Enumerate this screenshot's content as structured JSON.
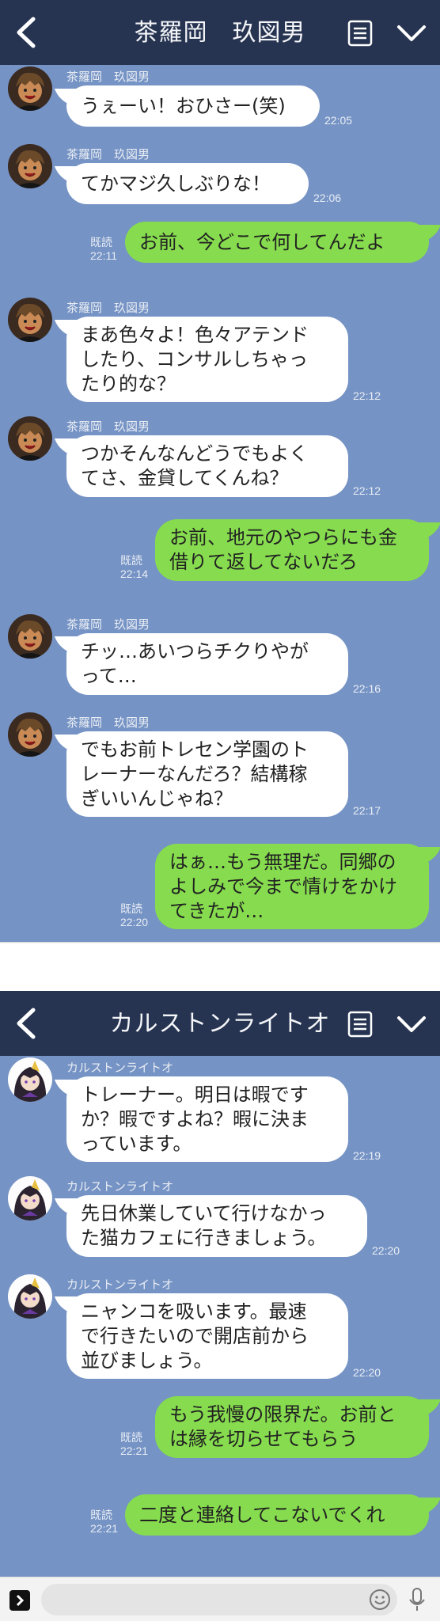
{
  "chat1": {
    "title": "茶羅岡　玖図男",
    "messages": [
      {
        "type": "in",
        "name": "茶羅岡　玖図男",
        "text": "うぇーい！おひさー(笑)",
        "time": "22:05"
      },
      {
        "type": "in",
        "name": "茶羅岡　玖図男",
        "text": "てかマジ久しぶりな！",
        "time": "22:06"
      },
      {
        "type": "out",
        "read": "既読",
        "text": "お前、今どこで何してんだよ",
        "time": "22:11"
      },
      {
        "type": "in",
        "name": "茶羅岡　玖図男",
        "text": "まあ色々よ！色々アテンド\nしたり、コンサルしちゃっ\nたり的な？",
        "time": "22:12"
      },
      {
        "type": "in",
        "name": "茶羅岡　玖図男",
        "text": "つかそんなんどうでもよく\nてさ、金貸してくんね？",
        "time": "22:12"
      },
      {
        "type": "out",
        "read": "既読",
        "text": "お前、地元のやつらにも金\n借りて返してないだろ",
        "time": "22:14"
      },
      {
        "type": "in",
        "name": "茶羅岡　玖図男",
        "text": "チッ…あいつらチクりやが\nって…",
        "time": "22:16"
      },
      {
        "type": "in",
        "name": "茶羅岡　玖図男",
        "text": "でもお前トレセン学園のト\nレーナーなんだろ？結構稼\nぎいいんじゃね？",
        "time": "22:17"
      },
      {
        "type": "out",
        "read": "既読",
        "text": "はぁ…もう無理だ。同郷の\nよしみで今まで情けをかけ\nてきたが…",
        "time": "22:20"
      }
    ]
  },
  "chat2": {
    "title": "カルストンライトオ",
    "messages": [
      {
        "type": "in",
        "name": "カルストンライトオ",
        "text": "トレーナー。明日は暇です\nか？暇ですよね？暇に決ま\nっています。",
        "time": "22:19"
      },
      {
        "type": "in",
        "name": "カルストンライトオ",
        "text": "先日休業していて行けなかっ\nた猫カフェに行きましょう。",
        "time": "22:20"
      },
      {
        "type": "in",
        "name": "カルストンライトオ",
        "text": "ニャンコを吸います。最速\nで行きたいので開店前から\n並びましょう。",
        "time": "22:20"
      },
      {
        "type": "out",
        "read": "既読",
        "text": "もう我慢の限界だ。お前と\nは縁を切らせてもらう",
        "time": "22:21"
      },
      {
        "type": "out",
        "read": "既読",
        "text": "二度と連絡してこないでくれ",
        "time": "22:21"
      }
    ]
  },
  "colors": {
    "bg": "#7593c4",
    "header": "#263451",
    "in_bubble": "#ffffff",
    "out_bubble": "#86dc4e"
  },
  "icons": [
    "back-icon",
    "menu-icon",
    "chevron-down-icon",
    "plus-icon",
    "emoji-icon",
    "mic-icon"
  ]
}
